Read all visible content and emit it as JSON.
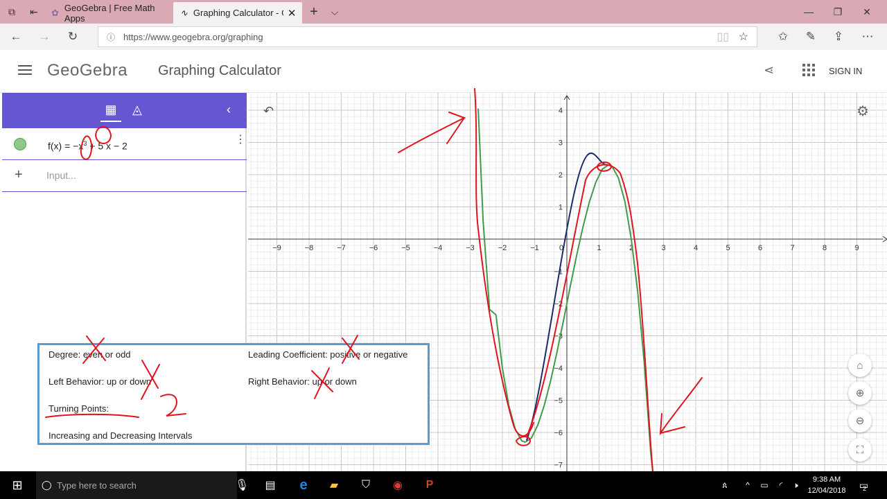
{
  "browser": {
    "tabs": [
      {
        "label": "GeoGebra | Free Math Apps"
      },
      {
        "label": "Graphing Calculator - G"
      }
    ],
    "new_tab": "+",
    "url": "https://www.geogebra.org/graphing",
    "window_controls": [
      "—",
      "❐",
      "✕"
    ]
  },
  "header": {
    "brand": "GeoGebra",
    "title": "Graphing Calculator",
    "sign_in": "SIGN IN"
  },
  "algebra": {
    "function_label": "f(x) = ",
    "function_rest": "−x",
    "exponent": "3",
    "function_tail": " + 5 x − 2",
    "input_placeholder": "Input..."
  },
  "graph": {
    "x_ticks": [
      "−9",
      "−8",
      "−7",
      "−6",
      "−5",
      "−4",
      "−3",
      "−2",
      "−1",
      "0",
      "1",
      "2",
      "3",
      "4",
      "5",
      "6",
      "7",
      "8",
      "9"
    ],
    "y_ticks": [
      "4",
      "3",
      "2",
      "1",
      "−1",
      "−2",
      "−3",
      "−4",
      "−5",
      "−6",
      "−7"
    ],
    "function_color": "#0f7a3a",
    "annotation_color": "#e0141e"
  },
  "chart_data": {
    "type": "line",
    "title": "",
    "xlabel": "",
    "ylabel": "",
    "xlim": [
      -9.5,
      9.5
    ],
    "ylim": [
      -7.3,
      4.5
    ],
    "series": [
      {
        "x": [
          -2.75,
          -2.6,
          -2.4,
          -2.2,
          -2,
          -1.8,
          -1.6,
          -1.4,
          -1.29,
          -1.1,
          -0.9,
          -0.7,
          -0.5,
          -0.3,
          -0.1,
          0.1,
          0.3,
          0.5,
          0.7,
          0.9,
          1.1,
          1.29,
          1.4,
          1.6,
          1.8,
          2,
          2.2,
          2.4,
          2.6,
          2.75
        ],
        "y": [
          4.05,
          0.58,
          -2.18,
          -2.35,
          -4,
          -5.17,
          -5.9,
          -6.26,
          -6.3,
          -6.17,
          -5.77,
          -5.16,
          -4.38,
          -3.47,
          -2.5,
          -1.5,
          -0.53,
          0.38,
          1.16,
          1.77,
          2.17,
          2.3,
          2.26,
          1.9,
          1.17,
          0,
          -1.65,
          -3.82,
          -6.58,
          -8.05
        ]
      }
    ]
  },
  "notes": {
    "degree": "Degree: even or odd",
    "leading": "Leading Coefficient: positive or negative",
    "left": "Left Behavior: up or down",
    "right": "Right Behavior: up or down",
    "turning": "Turning Points:",
    "intervals": "Increasing and Decreasing Intervals"
  },
  "taskbar": {
    "search_placeholder": "Type here to search",
    "time": "9:38 AM",
    "date": "12/04/2018",
    "notifications": "2"
  }
}
